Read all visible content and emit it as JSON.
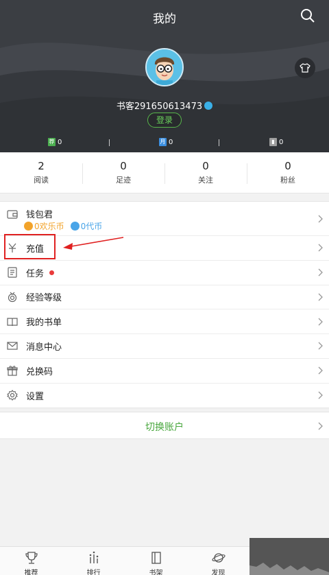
{
  "header": {
    "title": "我的"
  },
  "profile": {
    "username": "书客291650613473",
    "login_label": "登录"
  },
  "tickets": [
    {
      "badge": "荐",
      "value": "0",
      "color": "#4caf50"
    },
    {
      "badge": "月",
      "value": "0",
      "color": "#3b8fe0"
    },
    {
      "badge": "",
      "value": "0",
      "color": "#9e9e9e"
    }
  ],
  "stats": [
    {
      "value": "2",
      "label": "阅读"
    },
    {
      "value": "0",
      "label": "足迹"
    },
    {
      "value": "0",
      "label": "关注"
    },
    {
      "value": "0",
      "label": "粉丝"
    }
  ],
  "wallet": {
    "label": "钱包君",
    "happy_coins": "0欢乐币",
    "voucher": "0代币",
    "happy_color": "#f2a32a",
    "voucher_color": "#4aa5e8"
  },
  "menu": [
    {
      "label": "充值",
      "icon": "yen-icon"
    },
    {
      "label": "任务",
      "icon": "task-icon",
      "dot": true
    },
    {
      "label": "经验等级",
      "icon": "medal-icon"
    },
    {
      "label": "我的书单",
      "icon": "book-list-icon"
    },
    {
      "label": "消息中心",
      "icon": "mail-icon"
    },
    {
      "label": "兑换码",
      "icon": "gift-icon"
    },
    {
      "label": "设置",
      "icon": "gear-icon"
    }
  ],
  "switch_account": "切换账户",
  "nav": [
    {
      "label": "推荐",
      "icon": "trophy-icon"
    },
    {
      "label": "排行",
      "icon": "ranking-icon"
    },
    {
      "label": "书架",
      "icon": "bookshelf-icon"
    },
    {
      "label": "发现",
      "icon": "planet-icon"
    }
  ]
}
